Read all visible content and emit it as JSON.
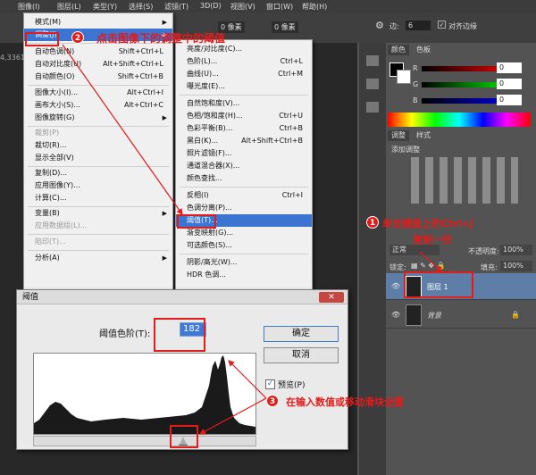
{
  "menubar": {
    "items": [
      "图像(I)",
      "图层(L)",
      "类型(Y)",
      "选择(S)",
      "滤镜(T)",
      "3D(D)",
      "视图(V)",
      "窗口(W)",
      "帮助(H)"
    ]
  },
  "optbar": {
    "width_label": "0 像素",
    "height_label": "0 像素",
    "edge_label": "边:",
    "edge_value": "6",
    "antialias": "对齐边缘"
  },
  "doc_label": "4,3361",
  "image_menu": {
    "items": [
      {
        "label": "模式(M)",
        "shortcut": "",
        "sub": true,
        "state": ""
      },
      {
        "label": "调整(J)",
        "shortcut": "",
        "sub": true,
        "state": "hl"
      },
      {
        "label": "自动色调(N)",
        "shortcut": "Shift+Ctrl+L",
        "sub": false,
        "state": ""
      },
      {
        "label": "自动对比度(U)",
        "shortcut": "Alt+Shift+Ctrl+L",
        "sub": false,
        "state": ""
      },
      {
        "label": "自动颜色(O)",
        "shortcut": "Shift+Ctrl+B",
        "sub": false,
        "state": ""
      },
      {
        "label": "图像大小(I)...",
        "shortcut": "Alt+Ctrl+I",
        "sub": false,
        "state": ""
      },
      {
        "label": "画布大小(S)...",
        "shortcut": "Alt+Ctrl+C",
        "sub": false,
        "state": ""
      },
      {
        "label": "图像旋转(G)",
        "shortcut": "",
        "sub": true,
        "state": ""
      },
      {
        "label": "裁剪(P)",
        "shortcut": "",
        "sub": false,
        "state": "dis"
      },
      {
        "label": "裁切(R)...",
        "shortcut": "",
        "sub": false,
        "state": ""
      },
      {
        "label": "显示全部(V)",
        "shortcut": "",
        "sub": false,
        "state": ""
      },
      {
        "label": "复制(D)...",
        "shortcut": "",
        "sub": false,
        "state": ""
      },
      {
        "label": "应用图像(Y)...",
        "shortcut": "",
        "sub": false,
        "state": ""
      },
      {
        "label": "计算(C)...",
        "shortcut": "",
        "sub": false,
        "state": ""
      },
      {
        "label": "变量(B)",
        "shortcut": "",
        "sub": true,
        "state": ""
      },
      {
        "label": "应用数据组(L)...",
        "shortcut": "",
        "sub": false,
        "state": "dis"
      },
      {
        "label": "陷印(T)...",
        "shortcut": "",
        "sub": false,
        "state": "dis"
      },
      {
        "label": "分析(A)",
        "shortcut": "",
        "sub": true,
        "state": ""
      }
    ]
  },
  "adjust_menu": {
    "items": [
      {
        "label": "亮度/对比度(C)...",
        "shortcut": ""
      },
      {
        "label": "色阶(L)...",
        "shortcut": "Ctrl+L"
      },
      {
        "label": "曲线(U)...",
        "shortcut": "Ctrl+M"
      },
      {
        "label": "曝光度(E)...",
        "shortcut": ""
      },
      {
        "label": "自然饱和度(V)...",
        "shortcut": ""
      },
      {
        "label": "色相/饱和度(H)...",
        "shortcut": "Ctrl+U"
      },
      {
        "label": "色彩平衡(B)...",
        "shortcut": "Ctrl+B"
      },
      {
        "label": "黑白(K)...",
        "shortcut": "Alt+Shift+Ctrl+B"
      },
      {
        "label": "照片滤镜(F)...",
        "shortcut": ""
      },
      {
        "label": "通道混合器(X)...",
        "shortcut": ""
      },
      {
        "label": "颜色查找...",
        "shortcut": ""
      },
      {
        "label": "反相(I)",
        "shortcut": "Ctrl+I"
      },
      {
        "label": "色调分离(P)...",
        "shortcut": ""
      },
      {
        "label": "阈值(T)...",
        "shortcut": ""
      },
      {
        "label": "渐变映射(G)...",
        "shortcut": ""
      },
      {
        "label": "可选颜色(S)...",
        "shortcut": ""
      },
      {
        "label": "阴影/高光(W)...",
        "shortcut": ""
      },
      {
        "label": "HDR 色调...",
        "shortcut": ""
      }
    ]
  },
  "dialog": {
    "title": "阈值",
    "close": "✕",
    "level_label": "阈值色阶(T):",
    "level_value": "182",
    "ok": "确定",
    "cancel": "取消",
    "preview": "预览(P)",
    "preview_checked": "✓"
  },
  "panel": {
    "color_tabs": [
      "颜色",
      "色板"
    ],
    "rgb": [
      {
        "ch": "R",
        "val": "0"
      },
      {
        "ch": "G",
        "val": "0"
      },
      {
        "ch": "B",
        "val": "0"
      }
    ],
    "adjust_tabs": [
      "调整",
      "样式"
    ],
    "adjust_title": "添加调整",
    "layers": {
      "blend": "正常",
      "opacity_label": "不透明度:",
      "opacity": "100%",
      "lock_label": "锁定:",
      "fill_label": "填充:",
      "fill": "100%",
      "list": [
        {
          "name": "图层 1",
          "italic": false
        },
        {
          "name": "背景",
          "italic": true
        }
      ]
    }
  },
  "annotations": {
    "step1_num": "1",
    "step1_line1": "单击键盘上的Ctrl+J",
    "step1_line2": "复制一份",
    "step2_num": "2",
    "step2": "点击图像下的调整中的阈值",
    "step3_num": "3",
    "step3": "在输入数值或移动滑块设置"
  },
  "colors": {
    "accent": "#e21b1b",
    "highlight": "#3b74d1"
  }
}
